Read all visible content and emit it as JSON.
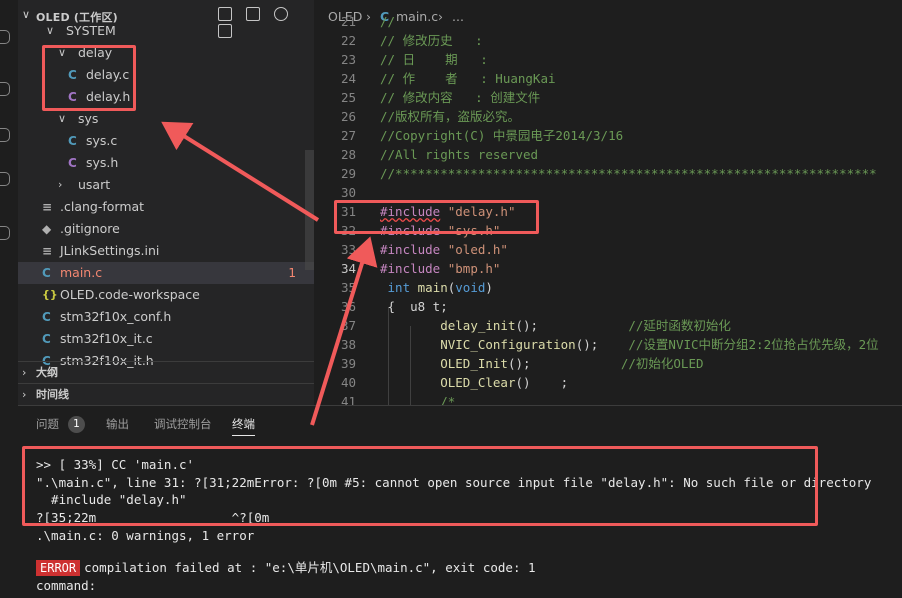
{
  "sidebar": {
    "title": "OLED (工作区)",
    "tree": [
      {
        "name": "tree-folder-system",
        "label": "SYSTEM",
        "type": "folder",
        "indent": 1,
        "open": true
      },
      {
        "name": "tree-folder-delay",
        "label": "delay",
        "type": "folder",
        "indent": 2,
        "open": true
      },
      {
        "name": "tree-file-delay-c",
        "label": "delay.c",
        "type": "c",
        "indent": 3
      },
      {
        "name": "tree-file-delay-h",
        "label": "delay.h",
        "type": "h",
        "indent": 3
      },
      {
        "name": "tree-folder-sys",
        "label": "sys",
        "type": "folder",
        "indent": 2,
        "open": true
      },
      {
        "name": "tree-file-sys-c",
        "label": "sys.c",
        "type": "c",
        "indent": 3
      },
      {
        "name": "tree-file-sys-h",
        "label": "sys.h",
        "type": "h",
        "indent": 3
      },
      {
        "name": "tree-folder-usart",
        "label": "usart",
        "type": "folder",
        "indent": 2,
        "open": false
      },
      {
        "name": "tree-file-clang-format",
        "label": ".clang-format",
        "type": "lines",
        "indent": 1
      },
      {
        "name": "tree-file-gitignore",
        "label": ".gitignore",
        "type": "git",
        "indent": 1
      },
      {
        "name": "tree-file-jlinksettings",
        "label": "JLinkSettings.ini",
        "type": "lines",
        "indent": 1
      },
      {
        "name": "tree-file-main-c",
        "label": "main.c",
        "type": "c",
        "indent": 1,
        "selected": true,
        "error": true,
        "errors": "1"
      },
      {
        "name": "tree-file-workspace",
        "label": "OLED.code-workspace",
        "type": "json",
        "indent": 1
      },
      {
        "name": "tree-file-stm32-conf",
        "label": "stm32f10x_conf.h",
        "type": "c",
        "indent": 1
      },
      {
        "name": "tree-file-stm32-it-c",
        "label": "stm32f10x_it.c",
        "type": "c",
        "indent": 1
      },
      {
        "name": "tree-file-stm32-it-h",
        "label": "stm32f10x_it.h",
        "type": "c",
        "indent": 1
      }
    ],
    "outline_label": "大纲",
    "timeline_label": "时间线",
    "icon_glyphs": {
      "c": "C",
      "h": "C",
      "json": "{}",
      "lines": "≡",
      "git": "◆"
    }
  },
  "breadcrumb": {
    "folder": "OLED",
    "separator": "›",
    "file_icon": "C",
    "file": "main.c",
    "ellipsis": "..."
  },
  "code": {
    "lines": [
      {
        "n": "21",
        "parts": [
          {
            "c": "cm",
            "t": "//"
          }
        ]
      },
      {
        "n": "22",
        "parts": [
          {
            "c": "cm",
            "t": "// 修改历史   :"
          }
        ]
      },
      {
        "n": "23",
        "parts": [
          {
            "c": "cm",
            "t": "// 日    期   :"
          }
        ]
      },
      {
        "n": "24",
        "parts": [
          {
            "c": "cm",
            "t": "// 作    者   : HuangKai"
          }
        ]
      },
      {
        "n": "25",
        "parts": [
          {
            "c": "cm",
            "t": "// 修改内容   : 创建文件"
          }
        ]
      },
      {
        "n": "26",
        "parts": [
          {
            "c": "cm",
            "t": "//版权所有，盗版必究。"
          }
        ]
      },
      {
        "n": "27",
        "parts": [
          {
            "c": "cm",
            "t": "//Copyright(C) 中景园电子2014/3/16"
          }
        ]
      },
      {
        "n": "28",
        "parts": [
          {
            "c": "cm",
            "t": "//All rights reserved"
          }
        ]
      },
      {
        "n": "29",
        "parts": [
          {
            "c": "cm",
            "t": "//****************************************************************"
          }
        ]
      },
      {
        "n": "30",
        "parts": []
      },
      {
        "n": "31",
        "parts": [
          {
            "c": "kw-pre squiggle",
            "t": "#include"
          },
          {
            "c": "id",
            "t": " "
          },
          {
            "c": "str",
            "t": "\"delay.h\""
          }
        ]
      },
      {
        "n": "32",
        "parts": [
          {
            "c": "kw-pre",
            "t": "#include"
          },
          {
            "c": "id",
            "t": " "
          },
          {
            "c": "str",
            "t": "\"sys.h\""
          }
        ]
      },
      {
        "n": "33",
        "parts": [
          {
            "c": "kw-pre",
            "t": "#include"
          },
          {
            "c": "id",
            "t": " "
          },
          {
            "c": "str",
            "t": "\"oled.h\""
          }
        ]
      },
      {
        "n": "34",
        "current": true,
        "parts": [
          {
            "c": "kw-pre",
            "t": "#include"
          },
          {
            "c": "id",
            "t": " "
          },
          {
            "c": "str",
            "t": "\"bmp.h\""
          }
        ]
      },
      {
        "n": "35",
        "parts": [
          {
            "c": "id",
            "t": " "
          },
          {
            "c": "kw",
            "t": "int"
          },
          {
            "c": "id",
            "t": " "
          },
          {
            "c": "fn",
            "t": "main"
          },
          {
            "c": "id",
            "t": "("
          },
          {
            "c": "kw",
            "t": "void"
          },
          {
            "c": "id",
            "t": ")"
          }
        ]
      },
      {
        "n": "36",
        "parts": [
          {
            "c": "id",
            "t": " {  u8 t;"
          }
        ]
      },
      {
        "n": "37",
        "parts": [
          {
            "c": "id",
            "t": "        "
          },
          {
            "c": "fn",
            "t": "delay_init"
          },
          {
            "c": "id",
            "t": "();            "
          },
          {
            "c": "cm",
            "t": "//延时函数初始化"
          }
        ]
      },
      {
        "n": "38",
        "parts": [
          {
            "c": "id",
            "t": "        "
          },
          {
            "c": "fn",
            "t": "NVIC_Configuration"
          },
          {
            "c": "id",
            "t": "();    "
          },
          {
            "c": "cm",
            "t": "//设置NVIC中断分组2:2位抢占优先级，2位"
          }
        ]
      },
      {
        "n": "39",
        "parts": [
          {
            "c": "id",
            "t": "        "
          },
          {
            "c": "fn",
            "t": "OLED_Init"
          },
          {
            "c": "id",
            "t": "();            "
          },
          {
            "c": "cm",
            "t": "//初始化OLED"
          }
        ]
      },
      {
        "n": "40",
        "parts": [
          {
            "c": "id",
            "t": "        "
          },
          {
            "c": "fn",
            "t": "OLED_Clear"
          },
          {
            "c": "id",
            "t": "()    ;"
          }
        ]
      },
      {
        "n": "41",
        "parts": [
          {
            "c": "id",
            "t": "        "
          },
          {
            "c": "cm",
            "t": "/*"
          }
        ]
      }
    ]
  },
  "panel": {
    "tabs": [
      {
        "name": "tab-problems",
        "label": "问题",
        "badge": "1"
      },
      {
        "name": "tab-output",
        "label": "输出"
      },
      {
        "name": "tab-debug-console",
        "label": "调试控制台"
      },
      {
        "name": "tab-terminal",
        "label": "终端",
        "active": true
      }
    ],
    "terminal": {
      "lines": [
        ">> [ 33%] CC 'main.c'",
        "\".\\main.c\", line 31: ?[31;22mError: ?[0m #5: cannot open source input file \"delay.h\": No such file or directory",
        "  #include \"delay.h\"",
        "?[35;22m                  ^?[0m",
        ".\\main.c: 0 warnings, 1 error",
        "",
        "compilation failed at : \"e:\\单片机\\OLED\\main.c\", exit code: 1",
        "command:"
      ],
      "error_tag": "ERROR"
    }
  },
  "colors": {
    "annotation": "#f05a5a",
    "error": "#f48771",
    "comment": "#6a9955",
    "preprocessor": "#c586c0",
    "string": "#ce9178",
    "keyword": "#569cd6",
    "function": "#dcdcaa"
  }
}
